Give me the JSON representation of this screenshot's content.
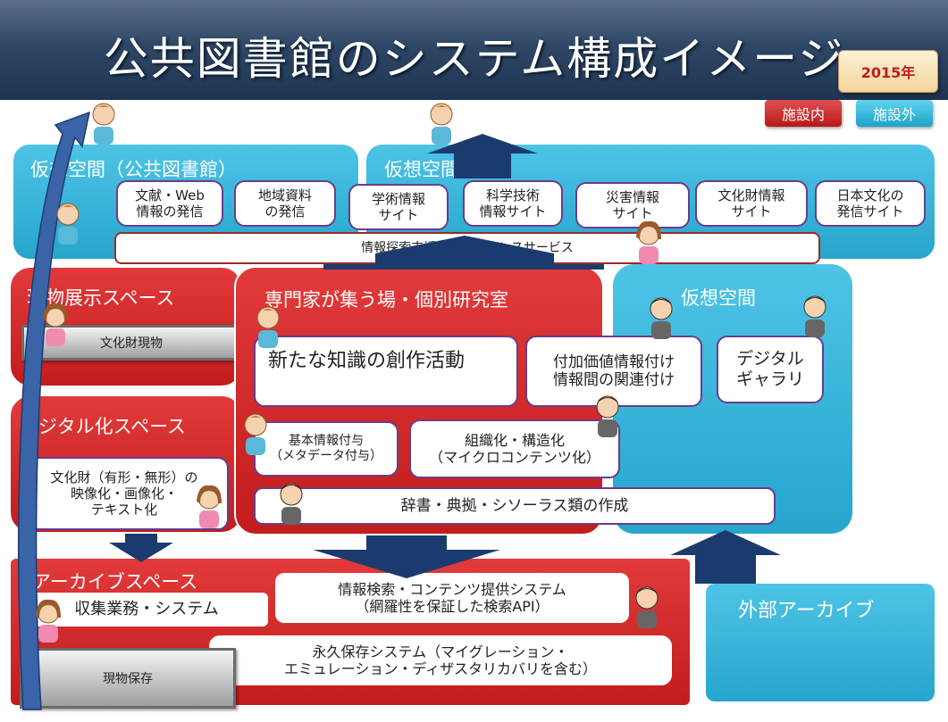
{
  "title": "公共図書館のシステム構成イメージ",
  "year": "2015年",
  "legend": {
    "inside": "施設内",
    "outside": "施設外"
  },
  "virtual_space_left": {
    "title": "仮想空間（公共図書館）"
  },
  "virtual_space_right": {
    "title": "仮想空間"
  },
  "virtual_sites": [
    "文献・Web\n情報の発信",
    "地域資料\nの発信",
    "学術情報\nサイト",
    "科学技術\n情報サイト",
    "災害情報\nサイト",
    "文化財情報\nサイト",
    "日本文化の\n発信サイト"
  ],
  "reference_service": "情報探索支援・レファレンスサービス",
  "exhibit_space": {
    "title": "現物展示スペース",
    "item": "文化財現物"
  },
  "digitize_space": {
    "title": "デジタル化スペース",
    "item": "文化財（有形・無形）の\n映像化・画像化・\nテキスト化"
  },
  "expert_room": {
    "title": "専門家が集う場・個別研究室",
    "creation": "新たな知識の創作活動",
    "value_added": "付加価値情報付け\n情報間の関連付け",
    "metadata": "基本情報付与\n（メタデータ付与）",
    "structuring": "組織化・構造化\n（マイクロコンテンツ化）",
    "dictionary": "辞書・典拠・シソーラス類の作成"
  },
  "virtual_space_panel": {
    "title": "仮想空間",
    "gallery": "デジタル\nギャラリ"
  },
  "archive_space": {
    "title": "アーカイブスペース",
    "collection": "収集業務・システム",
    "search": "情報検索・コンテンツ提供システム\n（網羅性を保証した検索API）",
    "preservation": "永久保存システム（マイグレーション・\nエミュレーション・ディザスタリカバリを含む）",
    "physical": "現物保存"
  },
  "external_archive": {
    "title": "外部アーカイブ"
  },
  "colors": {
    "red_panel": "#d42a2a",
    "blue_panel": "#35b3da",
    "header": "#2f4766",
    "arrow": "#1b3b6e"
  }
}
